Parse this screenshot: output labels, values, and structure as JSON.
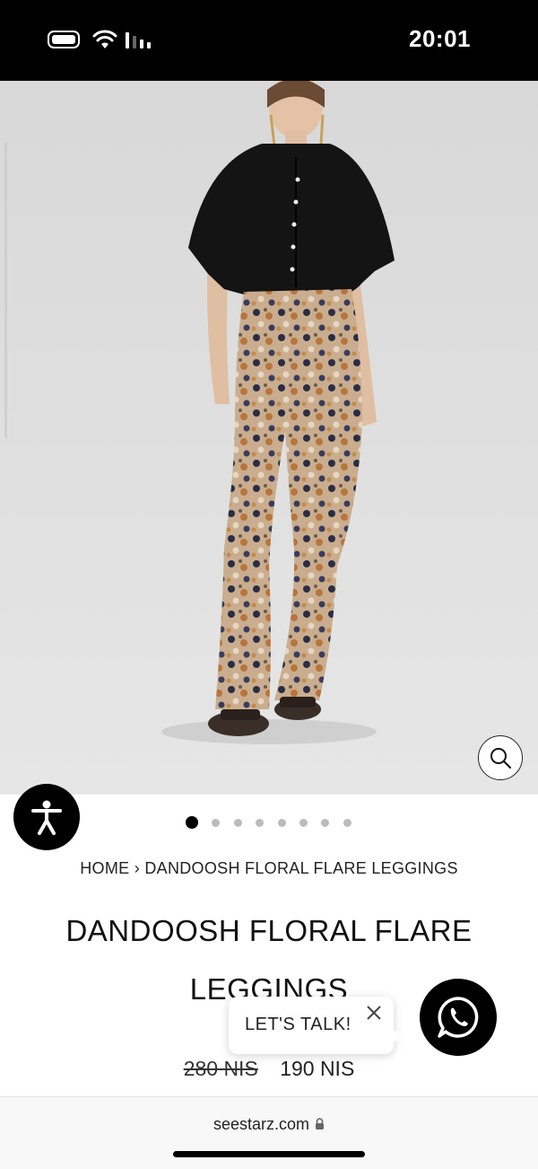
{
  "status_bar": {
    "time": "20:01",
    "icons": [
      "battery-icon",
      "wifi-icon",
      "signal-icon"
    ]
  },
  "product": {
    "image_alt": "model-wearing-black-shirt-and-floral-flare-leggings",
    "image_pager": {
      "total": 8,
      "active": 1
    },
    "breadcrumb": {
      "home": "HOME",
      "separator": "›",
      "current": "DANDOOSH FLORAL FLARE LEGGINGS"
    },
    "title": "DANDOOSH FLORAL FLARE LEGGINGS",
    "price": {
      "original": "280 NIS",
      "sale": "190 NIS"
    }
  },
  "chat_widget": {
    "label": "LET'S TALK!",
    "icons": [
      "close-icon",
      "whatsapp-icon"
    ]
  },
  "browser": {
    "url": "seestarz.com"
  },
  "colors": {
    "accent": "#000000",
    "background": "#ffffff",
    "image_backdrop": "#dcdcdc"
  }
}
